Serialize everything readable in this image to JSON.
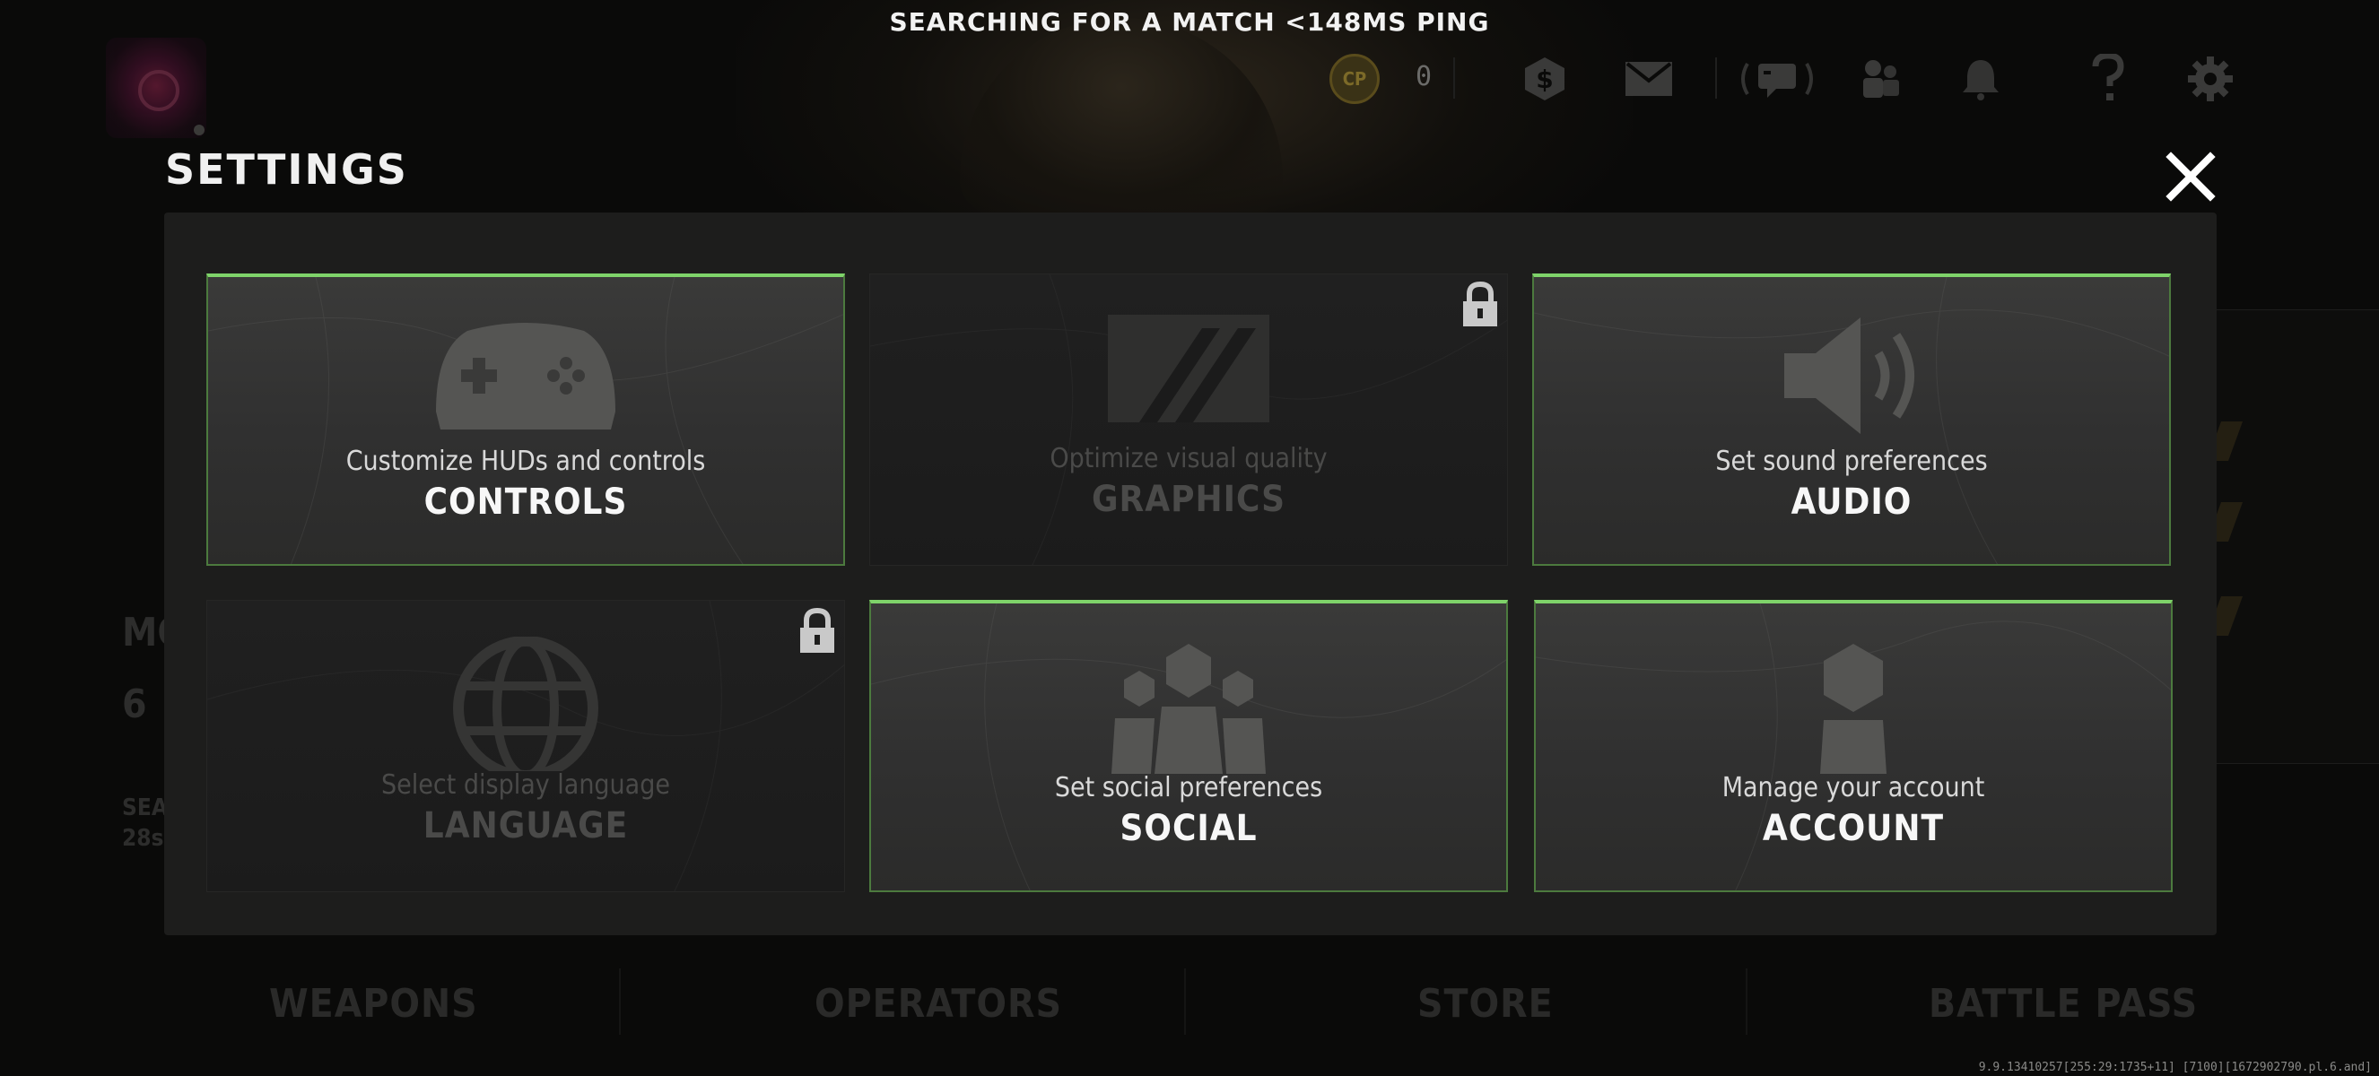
{
  "status_banner": "SEARCHING FOR A MATCH <148MS PING",
  "currency": {
    "icon": "cp-coin-icon",
    "label": "CP",
    "amount": "0"
  },
  "topbar_icons": [
    "store-dollar-icon",
    "mail-icon",
    "party-chat-icon",
    "friends-icon",
    "bell-icon",
    "help-icon",
    "gear-icon"
  ],
  "settings": {
    "title": "SETTINGS",
    "cards": [
      {
        "key": "controls",
        "subtitle": "Customize HUDs and controls",
        "title": "CONTROLS",
        "icon": "gamepad-icon",
        "locked": false
      },
      {
        "key": "graphics",
        "subtitle": "Optimize visual quality",
        "title": "GRAPHICS",
        "icon": "graphics-icon",
        "locked": true
      },
      {
        "key": "audio",
        "subtitle": "Set sound preferences",
        "title": "AUDIO",
        "icon": "speaker-icon",
        "locked": false
      },
      {
        "key": "language",
        "subtitle": "Select display language",
        "title": "LANGUAGE",
        "icon": "globe-icon",
        "locked": true
      },
      {
        "key": "social",
        "subtitle": "Set social preferences",
        "title": "SOCIAL",
        "icon": "social-group-icon",
        "locked": false
      },
      {
        "key": "account",
        "subtitle": "Manage your account",
        "title": "ACCOUNT",
        "icon": "account-user-icon",
        "locked": false
      }
    ]
  },
  "bottom_nav": {
    "items": [
      "WEAPONS",
      "OPERATORS",
      "STORE",
      "BATTLE PASS"
    ]
  },
  "left_residue": {
    "line1": "MO",
    "line2": "6",
    "line3": "SEA",
    "line4": "28s"
  },
  "build_info": "9.9.13410257[255:29:1735+11] [7100][1672902790.pl.6.and]",
  "colors": {
    "accent_green": "#7fd36a",
    "panel_bg": "#1d1d1c",
    "page_bg": "#0a0a09"
  }
}
